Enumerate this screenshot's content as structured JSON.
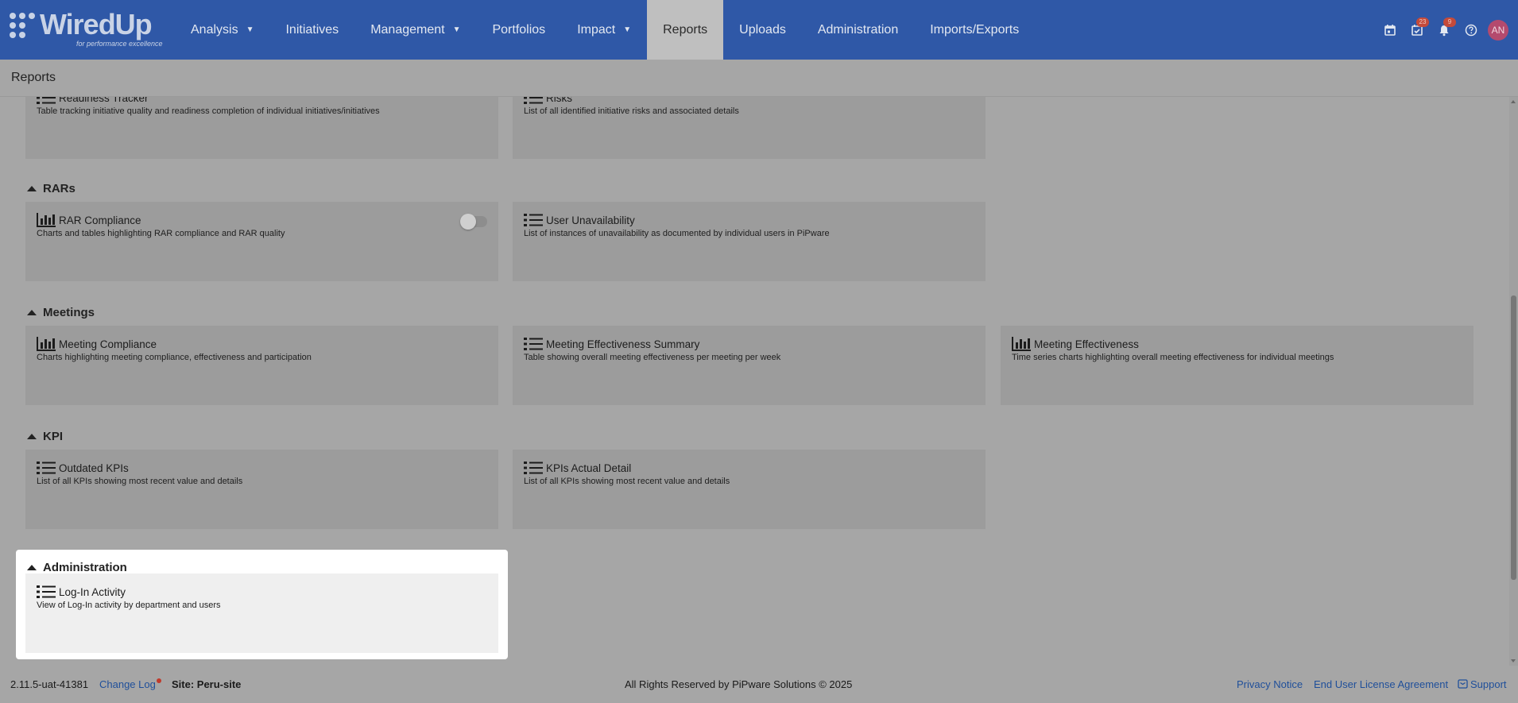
{
  "brand": {
    "name": "WiredUp",
    "tagline": "for performance excellence"
  },
  "nav": {
    "items": [
      {
        "label": "Analysis",
        "dropdown": true
      },
      {
        "label": "Initiatives",
        "dropdown": false
      },
      {
        "label": "Management",
        "dropdown": true
      },
      {
        "label": "Portfolios",
        "dropdown": false
      },
      {
        "label": "Impact",
        "dropdown": true
      },
      {
        "label": "Reports",
        "dropdown": false,
        "active": true
      },
      {
        "label": "Uploads",
        "dropdown": false
      },
      {
        "label": "Administration",
        "dropdown": false
      },
      {
        "label": "Imports/Exports",
        "dropdown": false
      }
    ],
    "tasks_badge": "23",
    "notifications_badge": "9",
    "avatar_initials": "AN"
  },
  "page": {
    "title": "Reports"
  },
  "sections": {
    "top": {
      "cards": [
        {
          "title": "Readiness Tracker",
          "desc": "Table tracking initiative quality and readiness completion of individual initiatives/initiatives",
          "icon": "list-icon"
        },
        {
          "title": "Risks",
          "desc": "List of all identified initiative risks and associated details",
          "icon": "list-icon"
        }
      ]
    },
    "rars": {
      "title": "RARs",
      "cards": [
        {
          "title": "RAR Compliance",
          "desc": "Charts and tables highlighting RAR compliance and RAR quality",
          "icon": "bar-chart-icon",
          "toggle": false
        },
        {
          "title": "User Unavailability",
          "desc": "List of instances of unavailability as documented by individual users in PiPware",
          "icon": "list-icon"
        }
      ]
    },
    "meetings": {
      "title": "Meetings",
      "cards": [
        {
          "title": "Meeting Compliance",
          "desc": "Charts highlighting meeting compliance, effectiveness and participation",
          "icon": "bar-chart-icon"
        },
        {
          "title": "Meeting Effectiveness Summary",
          "desc": "Table showing overall meeting effectiveness per meeting per week",
          "icon": "list-icon"
        },
        {
          "title": "Meeting Effectiveness",
          "desc": "Time series charts highlighting overall meeting effectiveness for individual meetings",
          "icon": "bar-chart-icon"
        }
      ]
    },
    "kpi": {
      "title": "KPI",
      "cards": [
        {
          "title": "Outdated KPIs",
          "desc": "List of all KPIs showing most recent value and details",
          "icon": "list-icon"
        },
        {
          "title": "KPIs Actual Detail",
          "desc": "List of all KPIs showing most recent value and details",
          "icon": "list-icon"
        }
      ]
    },
    "administration": {
      "title": "Administration",
      "cards": [
        {
          "title": "Log-In Activity",
          "desc": "View of Log-In activity by department and users",
          "icon": "list-icon"
        }
      ]
    }
  },
  "footer": {
    "version": "2.11.5-uat-41381",
    "changelog": "Change Log",
    "site": "Site: Peru-site",
    "copyright": "All Rights Reserved by PiPware Solutions © 2025",
    "privacy": "Privacy Notice",
    "eula": "End User License Agreement",
    "support": "Support"
  },
  "colors": {
    "header": "#2f58a7",
    "overlay": "#a6a6a6",
    "link": "#1f4f9a"
  }
}
